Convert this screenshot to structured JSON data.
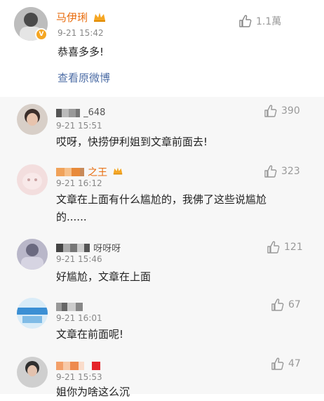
{
  "featured": {
    "name": "马伊琍",
    "time": "9-21 15:42",
    "likes": "1.1萬",
    "content": "恭喜多多!",
    "view_original": "查看原微博"
  },
  "comments": [
    {
      "name_suffix": "_648",
      "time": "9-21 15:51",
      "likes": "390",
      "content": "哎呀，快捞伊利姐到文章前面去!"
    },
    {
      "name_suffix": "之王",
      "time": "9-21 16:12",
      "likes": "323",
      "content_line1": "文章在上面有什么尴尬的，我佛了这些说尴尬",
      "content_line2": "的......"
    },
    {
      "name_suffix": "呀呀呀",
      "time": "9-21 15:46",
      "likes": "121",
      "content": "好尴尬，文章在上面"
    },
    {
      "name_suffix": "",
      "time": "9-21 16:01",
      "likes": "67",
      "content": "文章在前面呢!"
    },
    {
      "name_suffix": "",
      "time": "9-21 15:53",
      "likes": "47",
      "content": "姐你为啥这么沉"
    }
  ],
  "colors": {
    "accent_name": "#e86b0c",
    "link": "#4e6ea6",
    "comment_bg": "#f7f7f7"
  },
  "icons": [
    "thumbs-up-icon",
    "verified-badge-icon",
    "crown-icon"
  ]
}
